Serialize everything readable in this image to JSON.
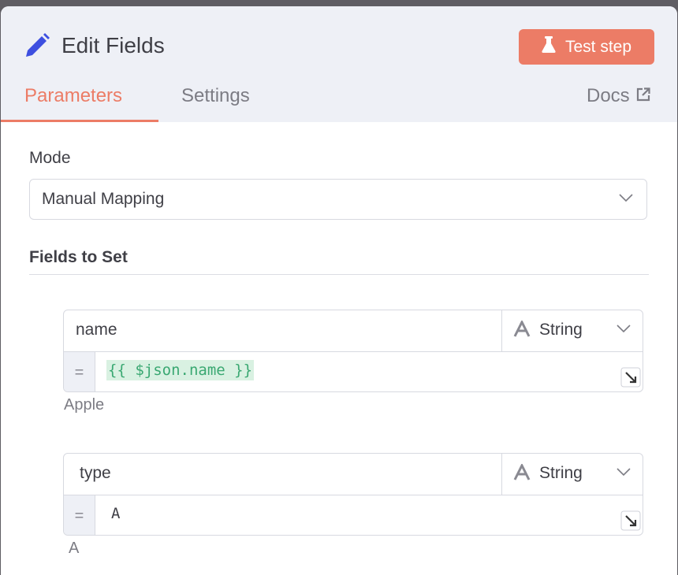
{
  "header": {
    "title": "Edit Fields",
    "test_button_label": "Test step",
    "tabs": [
      {
        "label": "Parameters",
        "active": true
      },
      {
        "label": "Settings",
        "active": false
      }
    ],
    "docs_label": "Docs"
  },
  "mode": {
    "label": "Mode",
    "value": "Manual Mapping"
  },
  "fields_section": {
    "title": "Fields to Set",
    "fields": [
      {
        "name": "name",
        "type": "String",
        "value": "{{ $json.name }}",
        "is_expression": true,
        "preview": "Apple"
      },
      {
        "name": "type",
        "type": "String",
        "value": "A",
        "is_expression": false,
        "preview": "A"
      }
    ]
  },
  "icons": {
    "title": "pencil-icon",
    "test": "flask-icon",
    "docs": "external-link-icon",
    "type": "string-type-icon",
    "chevron": "chevron-down-icon",
    "expand": "expand-icon"
  },
  "colors": {
    "accent": "#ec7c66",
    "pencil": "#3d4fe0",
    "expression_bg": "#d9f1e2",
    "expression_text": "#3aa872",
    "header_bg": "#eef0f6"
  }
}
